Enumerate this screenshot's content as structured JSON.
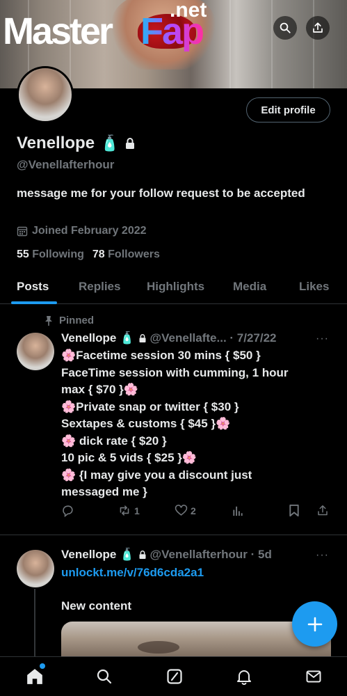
{
  "banner": {
    "logo_main": "MasterFap",
    "logo_master": "Master",
    "logo_fap": "Fap",
    "logo_suffix": ".net"
  },
  "header_actions": {
    "search_icon": "search-icon",
    "share_icon": "share-icon"
  },
  "profile": {
    "edit_label": "Edit profile",
    "display_name": "Venellope",
    "name_emoji": "🧴",
    "lock_icon": "lock-icon",
    "handle": "@Venellafterhour",
    "bio": "message me for your follow request to be accepted",
    "joined": "Joined February 2022",
    "following_count": "55",
    "following_label": "Following",
    "followers_count": "78",
    "followers_label": "Followers"
  },
  "tabs": [
    {
      "label": "Posts",
      "active": true
    },
    {
      "label": "Replies",
      "active": false
    },
    {
      "label": "Highlights",
      "active": false
    },
    {
      "label": "Media",
      "active": false
    },
    {
      "label": "Likes",
      "active": false
    }
  ],
  "pinned_post": {
    "pinned_label": "Pinned",
    "name": "Venellope",
    "emoji": "🧴",
    "handle_date": "@Venellafte... · 7/27/22",
    "more": "···",
    "lines": [
      "🌸Facetime session 30 mins { $50 }",
      "FaceTime session with cumming, 1 hour",
      "max { $70 }🌸",
      "🌸Private snap or twitter { $30 }",
      "Sextapes & customs { $45 }🌸",
      "🌸 dick rate { $20 }",
      "10 pic & 5 vids { $25 }🌸",
      "🌸 {I may give you a discount just",
      "messaged me }"
    ],
    "retweets": "1",
    "likes": "2"
  },
  "second_post": {
    "name": "Venellope",
    "emoji": "🧴",
    "handle_date": "@Venellafterhour · 5d",
    "more": "···",
    "link": "unlockt.me/v/76d6cda2a1",
    "caption": "New content"
  },
  "colors": {
    "accent": "#1d9bf0",
    "muted": "#71767b",
    "text": "#e7e9ea",
    "divider": "#2f3336"
  },
  "bottom_nav": [
    "home-icon",
    "search-icon",
    "grok-icon",
    "notifications-icon",
    "messages-icon"
  ]
}
